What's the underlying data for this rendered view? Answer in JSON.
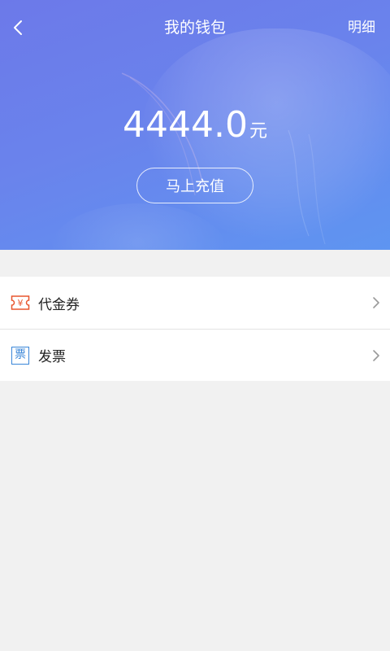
{
  "header": {
    "title": "我的钱包",
    "detail_label": "明细",
    "back_icon": "chevron-left-icon"
  },
  "wallet": {
    "balance": "4444.0",
    "unit": "元",
    "recharge_label": "马上充值"
  },
  "menu": {
    "items": [
      {
        "label": "代金券",
        "icon": "voucher-icon",
        "icon_glyph": "¥",
        "color": "#e8562e"
      },
      {
        "label": "发票",
        "icon": "invoice-icon",
        "icon_glyph": "票",
        "color": "#3a86d8"
      }
    ]
  },
  "colors": {
    "header_start": "#6c79e9",
    "header_end": "#5e95f1",
    "page_background": "#f1f1f1"
  }
}
